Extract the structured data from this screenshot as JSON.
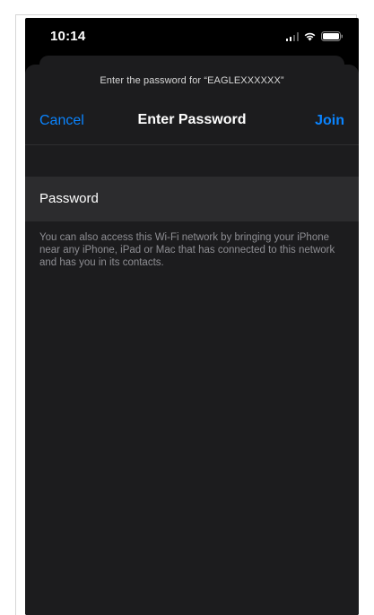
{
  "status_bar": {
    "time": "10:14",
    "icons": [
      "cellular-signal-icon",
      "wifi-icon",
      "battery-icon"
    ]
  },
  "sheet": {
    "prompt": "Enter the password for “EAGLEXXXXXX”",
    "nav": {
      "cancel_label": "Cancel",
      "title": "Enter Password",
      "join_label": "Join"
    },
    "password_field": {
      "label": "Password",
      "value": "",
      "placeholder": ""
    },
    "footer_note": "You can also access this Wi-Fi network by bringing your iPhone near any iPhone, iPad or Mac that has connected to this network and has you in its contacts."
  },
  "colors": {
    "accent": "#0a84ff",
    "background": "#000000",
    "sheet": "#1c1c1e",
    "field": "#2c2c2e",
    "secondary_text": "#8e8e93"
  }
}
